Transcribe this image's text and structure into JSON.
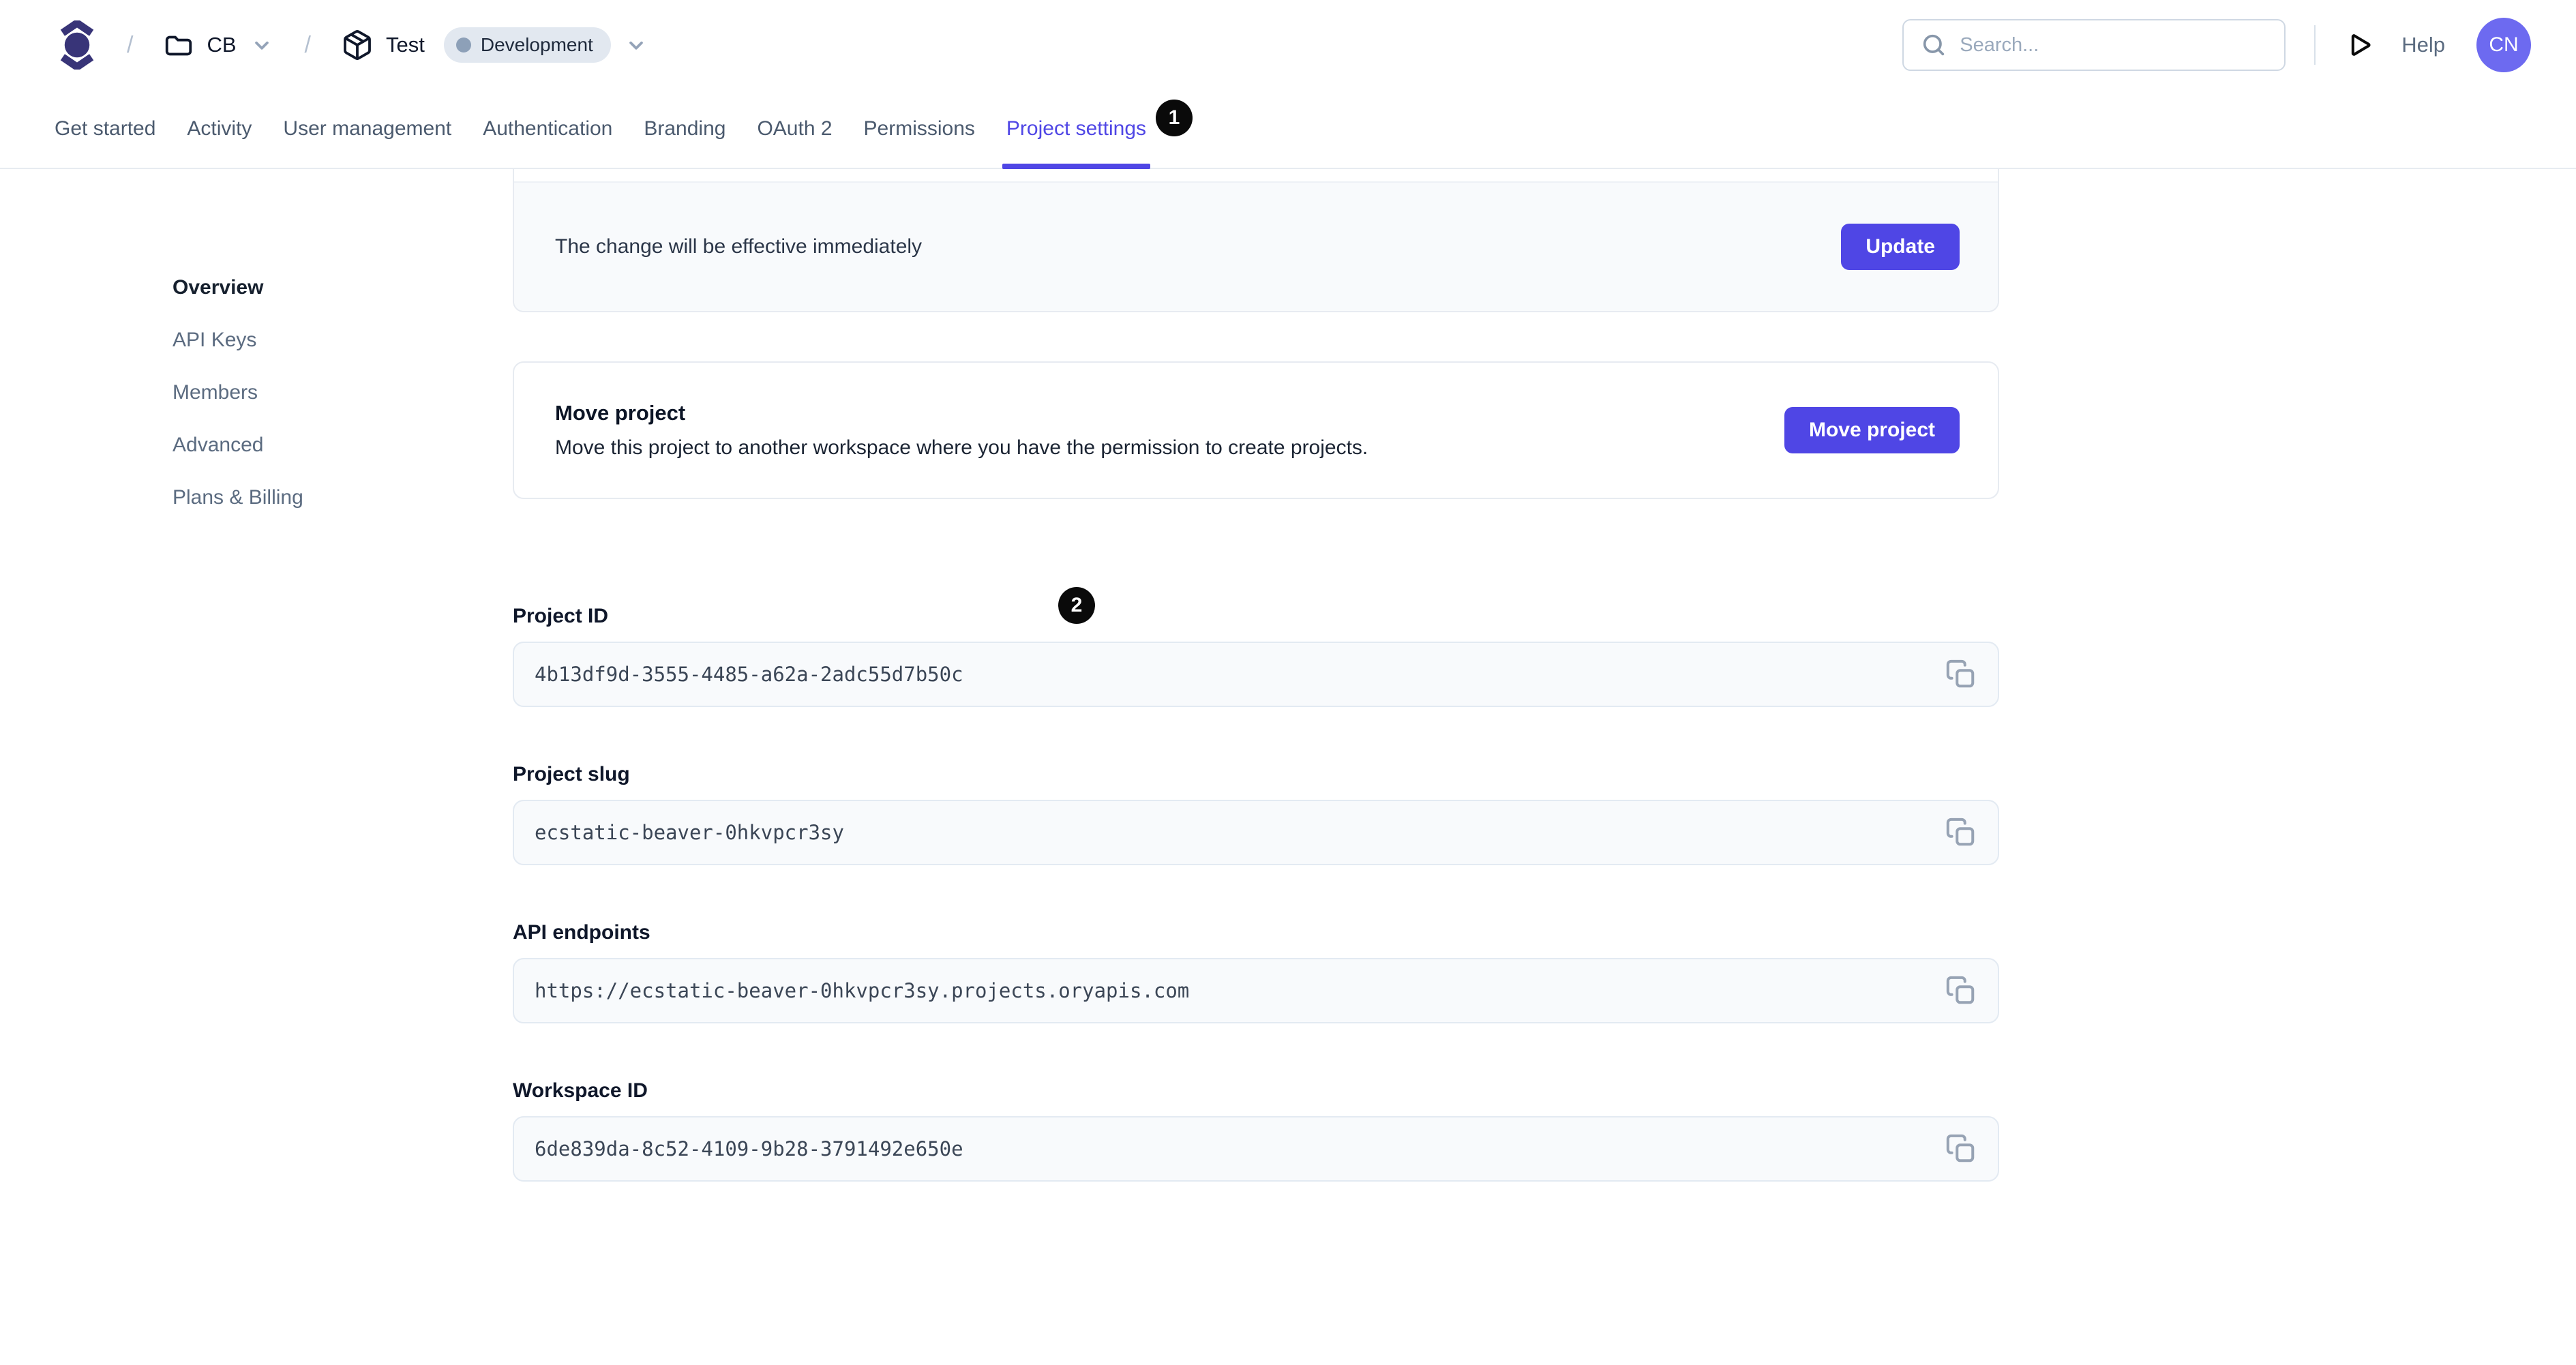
{
  "header": {
    "breadcrumb": {
      "separator": "/",
      "workspace": "CB",
      "project": "Test",
      "environment": "Development"
    },
    "search": {
      "placeholder": "Search..."
    },
    "help_label": "Help",
    "avatar_initials": "CN"
  },
  "tabs": {
    "items": [
      {
        "label": "Get started"
      },
      {
        "label": "Activity"
      },
      {
        "label": "User management"
      },
      {
        "label": "Authentication"
      },
      {
        "label": "Branding"
      },
      {
        "label": "OAuth 2"
      },
      {
        "label": "Permissions"
      },
      {
        "label": "Project settings"
      }
    ],
    "active": "Project settings",
    "active_badge": "1"
  },
  "sidebar": {
    "active": "Overview",
    "items": [
      {
        "label": "Overview"
      },
      {
        "label": "API Keys"
      },
      {
        "label": "Members"
      },
      {
        "label": "Advanced"
      },
      {
        "label": "Plans & Billing"
      }
    ]
  },
  "main": {
    "update_card": {
      "message": "The change will be effective immediately",
      "button_label": "Update"
    },
    "move_card": {
      "title": "Move project",
      "description": "Move this project to another workspace where you have the permission to create projects.",
      "button_label": "Move project"
    },
    "step_badge": "2",
    "fields": [
      {
        "label": "Project ID",
        "value": "4b13df9d-3555-4485-a62a-2adc55d7b50c"
      },
      {
        "label": "Project slug",
        "value": "ecstatic-beaver-0hkvpcr3sy"
      },
      {
        "label": "API endpoints",
        "value": "https://ecstatic-beaver-0hkvpcr3sy.projects.oryapis.com"
      },
      {
        "label": "Workspace ID",
        "value": "6de839da-8c52-4109-9b28-3791492e650e"
      }
    ]
  },
  "colors": {
    "accent": "#4f46e5",
    "avatar": "#6d6af0",
    "logo": "#383478",
    "badge_background": "#0a0a0a",
    "field_background": "#f8fafc",
    "footer_background": "#f8fafc",
    "border": "#e7ebf1"
  }
}
